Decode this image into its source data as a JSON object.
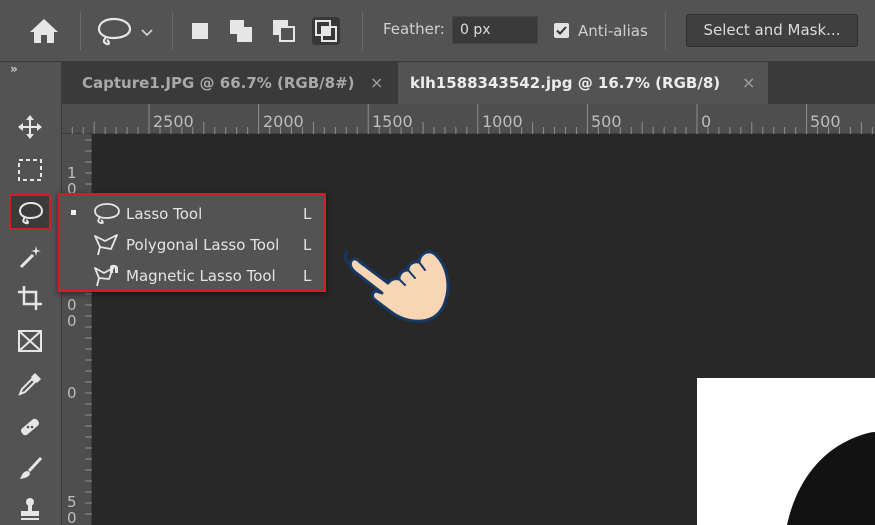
{
  "options_bar": {
    "feather_label": "Feather:",
    "feather_value": "0 px",
    "antialias_label": "Anti-alias",
    "antialias_checked": true,
    "select_mask_label": "Select and Mask...",
    "icons": [
      "home-icon",
      "lasso-preset-icon",
      "chevron-down-icon",
      "new-selection-icon",
      "add-to-selection-icon",
      "subtract-selection-icon",
      "intersect-selection-icon"
    ]
  },
  "toolbar": {
    "collapse_label": "»",
    "tools": [
      "move-icon",
      "marquee-icon",
      "lasso-icon",
      "magic-wand-icon",
      "crop-icon",
      "frame-icon",
      "eyedropper-icon",
      "healing-brush-icon",
      "brush-icon",
      "clone-stamp-icon"
    ],
    "active_tool": "lasso-icon"
  },
  "tabs": [
    {
      "label": "Capture1.JPG @ 66.7% (RGB/8#)",
      "active": false,
      "close": "×"
    },
    {
      "label": "klh1588343542.jpg @ 16.7% (RGB/8)",
      "active": true,
      "close": "×"
    }
  ],
  "ruler": {
    "horizontal_labels": [
      "2500",
      "2000",
      "1500",
      "1000",
      "500",
      "0",
      "500"
    ],
    "vertical_labels": [
      "1",
      "0",
      "0",
      "0",
      "0",
      "5",
      "0"
    ]
  },
  "flyout": {
    "items": [
      {
        "label": "Lasso Tool",
        "shortcut": "L",
        "icon": "lasso-icon",
        "selected": true
      },
      {
        "label": "Polygonal Lasso Tool",
        "shortcut": "L",
        "icon": "polygonal-lasso-icon",
        "selected": false
      },
      {
        "label": "Magnetic Lasso Tool",
        "shortcut": "L",
        "icon": "magnetic-lasso-icon",
        "selected": false
      }
    ]
  },
  "colors": {
    "highlight_border": "#d01f24",
    "panel": "#535353",
    "canvas": "#282828",
    "hand_fill": "#f7d5b5",
    "hand_outline": "#163a66"
  }
}
